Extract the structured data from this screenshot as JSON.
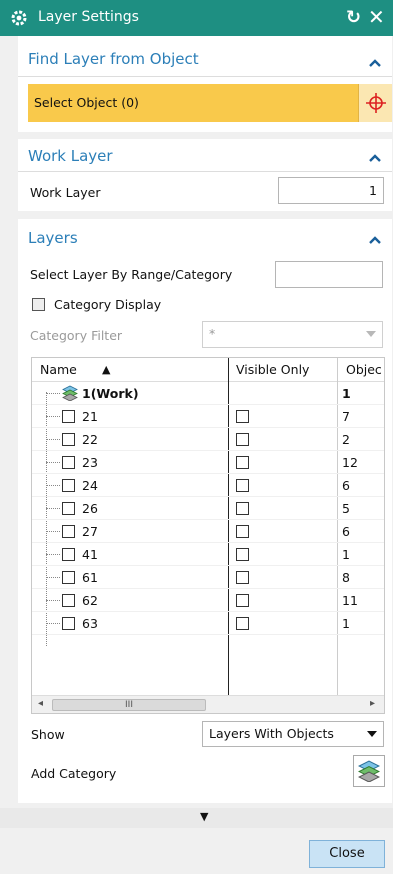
{
  "window": {
    "title": "Layer Settings",
    "reset_glyph": "↻",
    "close_glyph": "✕",
    "icons": [
      "gear-icon",
      "reset-icon",
      "close-icon"
    ]
  },
  "colors": {
    "titlebar": "#1e8f82",
    "section_heading": "#2c7fb8",
    "selection_highlight": "#f9c94b",
    "close_button": "#c9e3f5"
  },
  "find_layer": {
    "heading": "Find Layer from Object",
    "select_object_label": "Select Object (0)",
    "crosshair_icon": "crosshair-icon"
  },
  "work_layer": {
    "heading": "Work Layer",
    "label": "Work Layer",
    "value": "1"
  },
  "layers": {
    "heading": "Layers",
    "range_label": "Select Layer By Range/Category",
    "range_value": "",
    "category_display_label": "Category Display",
    "category_display_checked": false,
    "category_filter_label": "Category Filter",
    "category_filter_value": "*",
    "table": {
      "columns": [
        "Name",
        "Visible Only",
        "Objec"
      ],
      "sort_indicator": "▲",
      "work_row": {
        "name": "1(Work)",
        "objects": "1"
      },
      "rows": [
        {
          "name": "21",
          "objects": "7",
          "selected": false,
          "visible_only": false
        },
        {
          "name": "22",
          "objects": "2",
          "selected": false,
          "visible_only": false
        },
        {
          "name": "23",
          "objects": "12",
          "selected": false,
          "visible_only": false
        },
        {
          "name": "24",
          "objects": "6",
          "selected": false,
          "visible_only": false
        },
        {
          "name": "26",
          "objects": "5",
          "selected": false,
          "visible_only": false
        },
        {
          "name": "27",
          "objects": "6",
          "selected": false,
          "visible_only": false
        },
        {
          "name": "41",
          "objects": "1",
          "selected": false,
          "visible_only": false
        },
        {
          "name": "61",
          "objects": "8",
          "selected": false,
          "visible_only": false
        },
        {
          "name": "62",
          "objects": "11",
          "selected": false,
          "visible_only": false
        },
        {
          "name": "63",
          "objects": "1",
          "selected": false,
          "visible_only": false
        }
      ],
      "scroll_thumb_glyph": "III",
      "scroll_left_glyph": "◂",
      "scroll_right_glyph": "▸"
    },
    "show_label": "Show",
    "show_value": "Layers With Objects",
    "add_category_label": "Add Category"
  },
  "footer": {
    "more_glyph": "▼",
    "close_label": "Close"
  }
}
